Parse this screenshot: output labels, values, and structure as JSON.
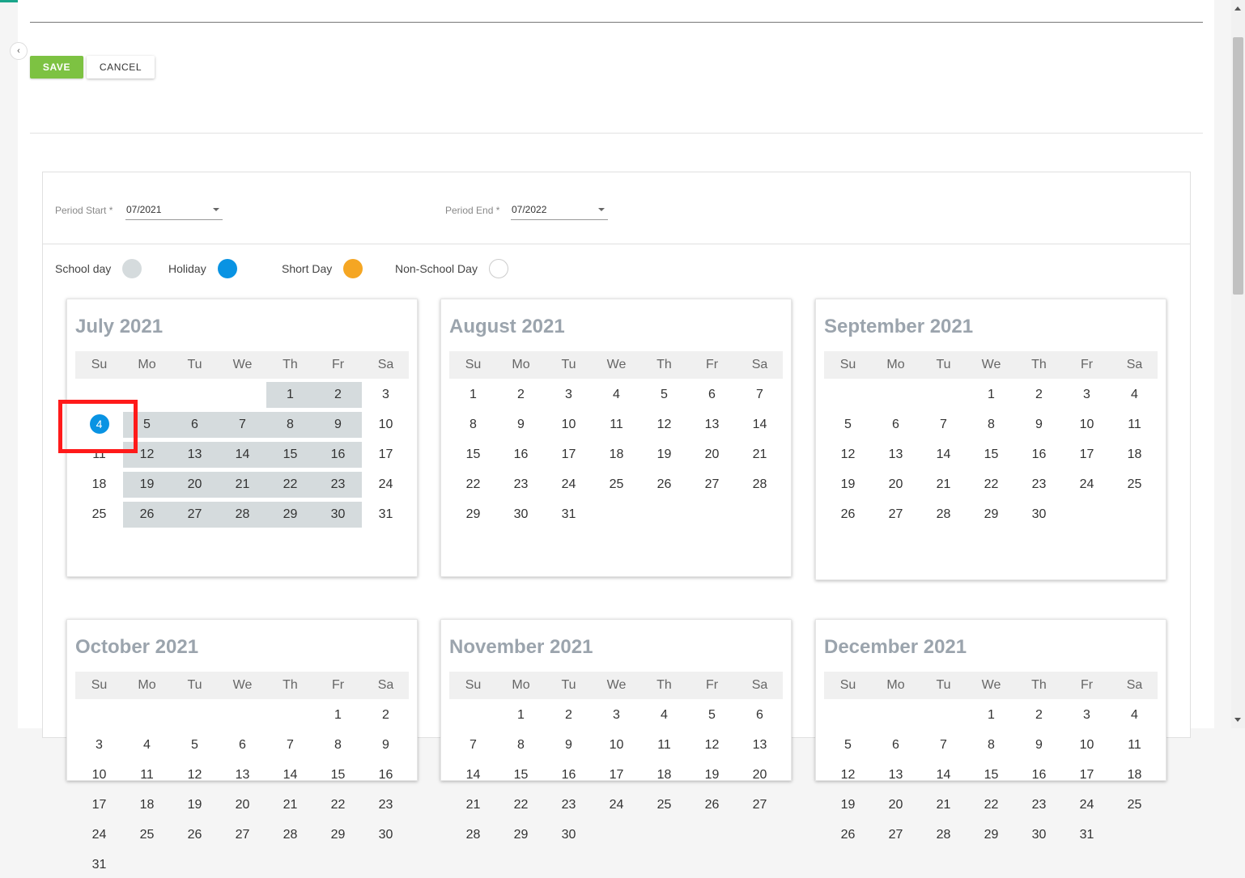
{
  "toolbar": {
    "save_label": "SAVE",
    "cancel_label": "CANCEL"
  },
  "period": {
    "start_label": "Period Start *",
    "start_value": "07/2021",
    "end_label": "Period End *",
    "end_value": "07/2022"
  },
  "legend": [
    {
      "label": "School day",
      "color": "#d5dbdd"
    },
    {
      "label": "Holiday",
      "color": "#0993e3"
    },
    {
      "label": "Short Day",
      "color": "#f5a623"
    },
    {
      "label": "Non-School Day",
      "color": "#ffffff"
    }
  ],
  "weekdays": [
    "Su",
    "Mo",
    "Tu",
    "We",
    "Th",
    "Fr",
    "Sa"
  ],
  "months": [
    {
      "title": "July 2021",
      "first_weekday": 4,
      "days": 31,
      "school_days_marked": true,
      "holidays": [
        4
      ]
    },
    {
      "title": "August 2021",
      "first_weekday": 0,
      "days": 31,
      "school_days_marked": false,
      "holidays": []
    },
    {
      "title": "September 2021",
      "first_weekday": 3,
      "days": 30,
      "school_days_marked": false,
      "holidays": []
    },
    {
      "title": "October 2021",
      "first_weekday": 5,
      "days": 31,
      "school_days_marked": false,
      "holidays": []
    },
    {
      "title": "November 2021",
      "first_weekday": 1,
      "days": 30,
      "school_days_marked": false,
      "holidays": []
    },
    {
      "title": "December 2021",
      "first_weekday": 3,
      "days": 31,
      "school_days_marked": false,
      "holidays": []
    }
  ],
  "icons": {
    "collapse": "chevron-left-icon",
    "dropdown": "caret-down-icon"
  }
}
